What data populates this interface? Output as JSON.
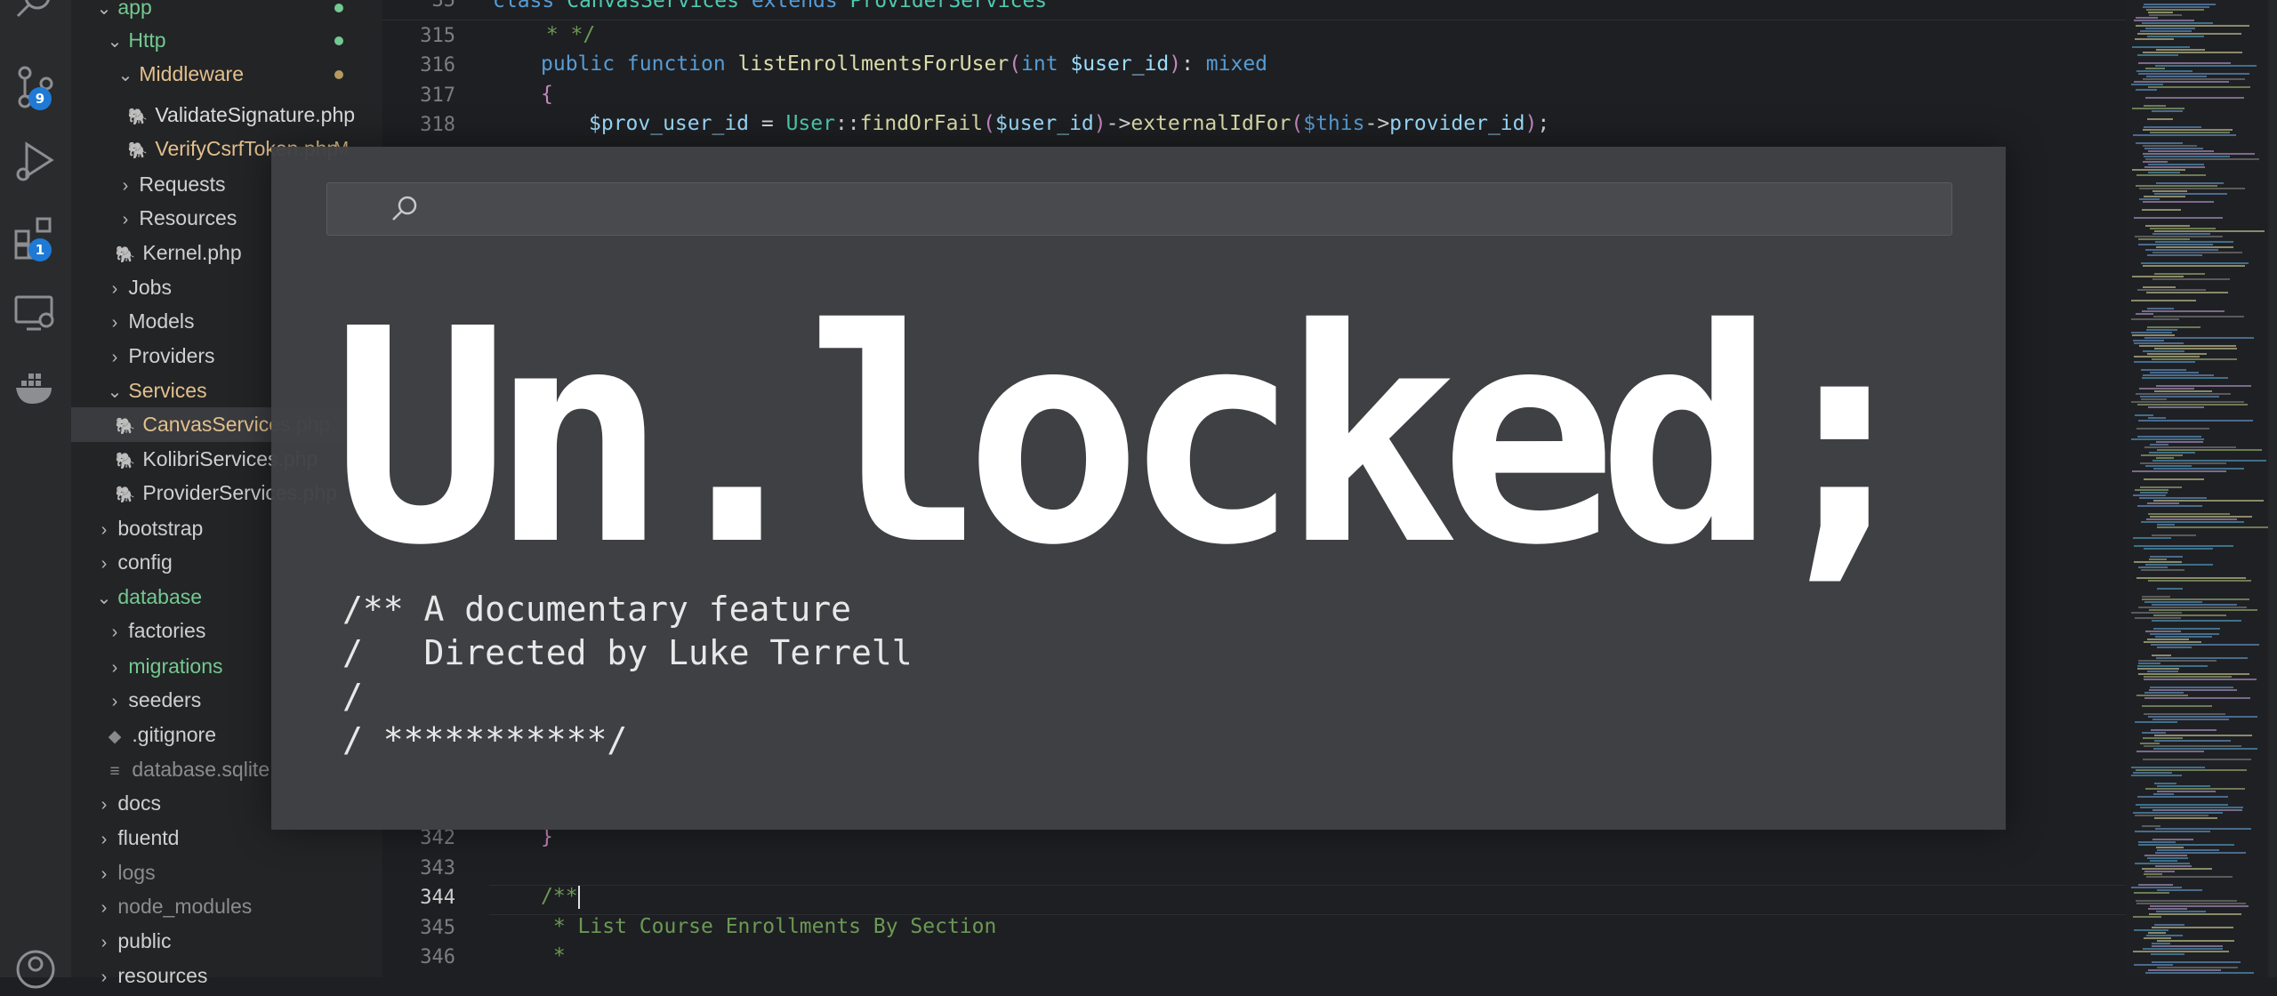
{
  "activity_bar": {
    "source_control_badge": "9",
    "extensions_badge": "1"
  },
  "explorer": {
    "items": [
      {
        "label": "app",
        "name": "folder-app"
      },
      {
        "label": "Http",
        "name": "folder-http"
      },
      {
        "label": "Middleware",
        "name": "folder-middleware"
      },
      {
        "label": "ValidateSignature.php",
        "name": "file-validatesignature"
      },
      {
        "label": "VerifyCsrfToken.php",
        "name": "file-verifycsrftoken",
        "status": "M"
      },
      {
        "label": "Requests",
        "name": "folder-requests"
      },
      {
        "label": "Resources",
        "name": "folder-resources"
      },
      {
        "label": "Kernel.php",
        "name": "file-kernel"
      },
      {
        "label": "Jobs",
        "name": "folder-jobs"
      },
      {
        "label": "Models",
        "name": "folder-models"
      },
      {
        "label": "Providers",
        "name": "folder-providers"
      },
      {
        "label": "Services",
        "name": "folder-services"
      },
      {
        "label": "CanvasServices.php",
        "name": "file-canvasservices"
      },
      {
        "label": "KolibriServices.php",
        "name": "file-kolibriservices"
      },
      {
        "label": "ProviderServices.php",
        "name": "file-providerservices"
      },
      {
        "label": "bootstrap",
        "name": "folder-bootstrap"
      },
      {
        "label": "config",
        "name": "folder-config"
      },
      {
        "label": "database",
        "name": "folder-database"
      },
      {
        "label": "factories",
        "name": "folder-factories"
      },
      {
        "label": "migrations",
        "name": "folder-migrations"
      },
      {
        "label": "seeders",
        "name": "folder-seeders"
      },
      {
        "label": ".gitignore",
        "name": "file-gitignore"
      },
      {
        "label": "database.sqlite",
        "name": "file-database-sqlite"
      },
      {
        "label": "docs",
        "name": "folder-docs"
      },
      {
        "label": "fluentd",
        "name": "folder-fluentd"
      },
      {
        "label": "logs",
        "name": "folder-logs"
      },
      {
        "label": "node_modules",
        "name": "folder-node-modules"
      },
      {
        "label": "public",
        "name": "folder-public"
      },
      {
        "label": "resources",
        "name": "folder-resources-root"
      }
    ]
  },
  "editor": {
    "sticky_line_number": "35",
    "sticky_class": "CanvasServices",
    "sticky_parent": "ProviderServices",
    "line_numbers": [
      "315",
      "316",
      "317",
      "318",
      "342",
      "343",
      "344",
      "345",
      "346"
    ],
    "line_315": " * */",
    "line_316_fn": "listEnrollmentsForUser",
    "line_316_param": "$user_id",
    "line_318_var": "$prov_user_id",
    "line_318_class": "User",
    "line_318_call": "findOrFail",
    "line_318_arg": "$user_id",
    "line_318_method": "externalIdFor",
    "line_318_this": "$this",
    "line_318_prop": "provider_id",
    "line_345": " * List Course Enrollments By Section",
    "line_346": " *"
  },
  "overlay": {
    "search_placeholder": "",
    "title": "Un.locked;",
    "subtitle_lines": [
      "/** A documentary feature",
      "/   Directed by Luke Terrell",
      "/",
      "/ ***********/"
    ]
  }
}
